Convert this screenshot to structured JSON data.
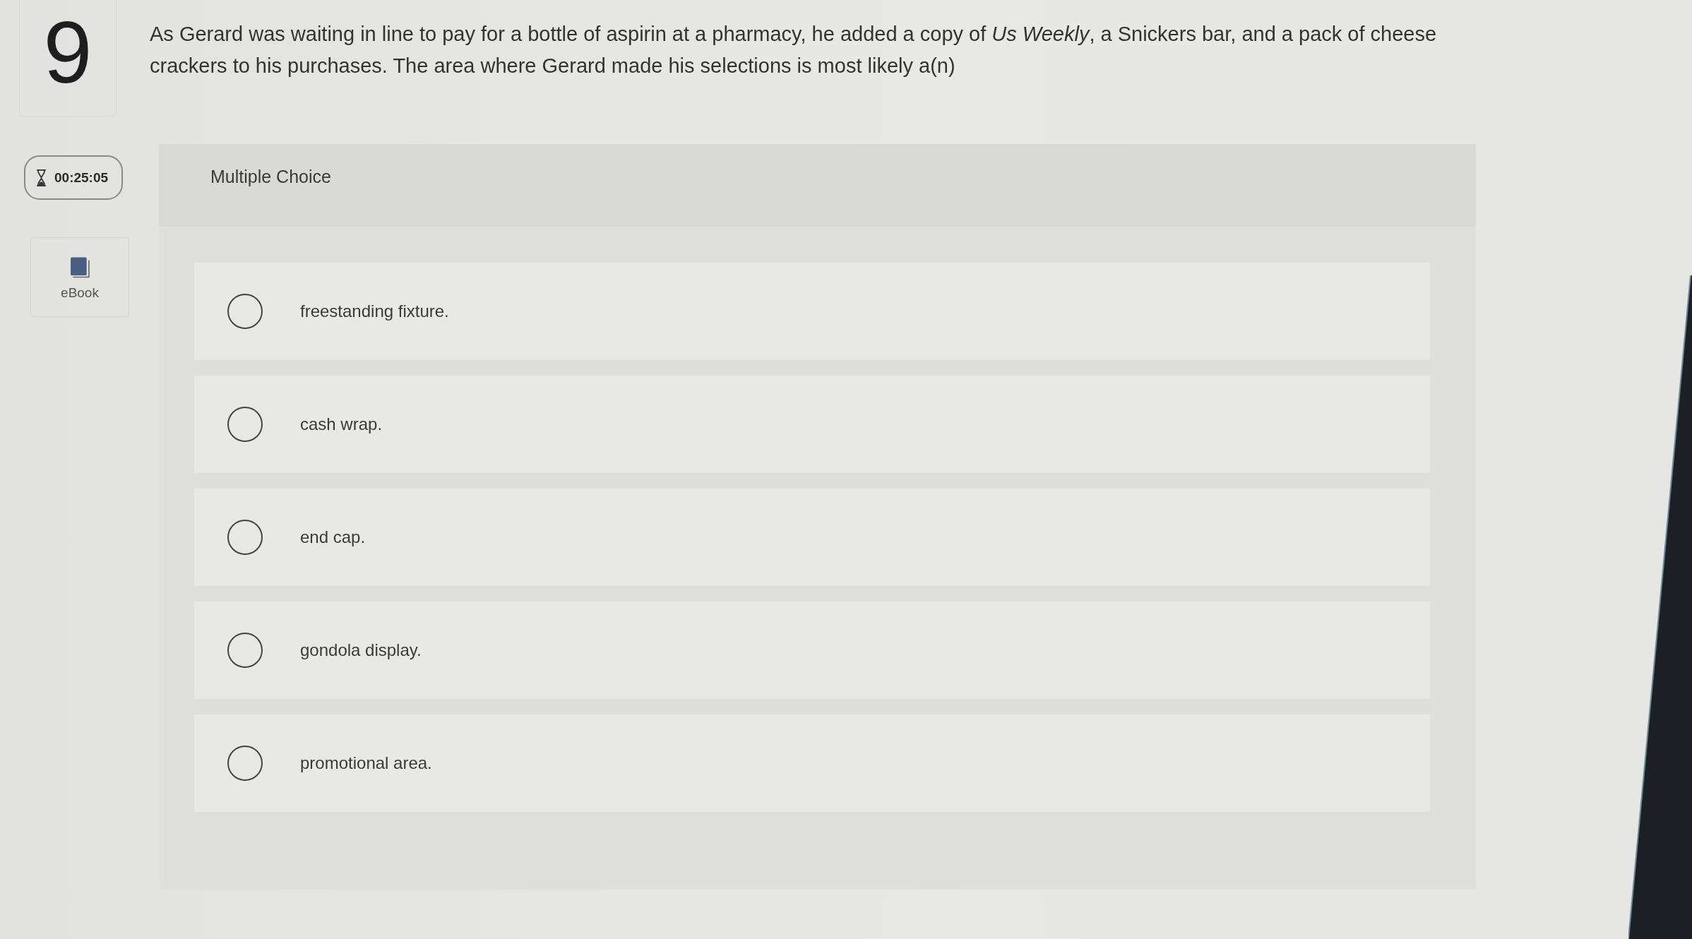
{
  "question": {
    "number": "9",
    "text": "As Gerard was waiting in line to pay for a bottle of aspirin at a pharmacy, he added a copy of *Us Weekly*, a Snickers bar, and a pack of cheese crackers to his purchases. The area where Gerard made his selections is most likely a(n)"
  },
  "timer": {
    "time": "00:25:05"
  },
  "ebook": {
    "label": "eBook"
  },
  "panel": {
    "title": "Multiple Choice"
  },
  "options": [
    {
      "label": "freestanding fixture.",
      "selected": false
    },
    {
      "label": "cash wrap.",
      "selected": false
    },
    {
      "label": "end cap.",
      "selected": false
    },
    {
      "label": "gondola display.",
      "selected": false
    },
    {
      "label": "promotional area.",
      "selected": false
    }
  ]
}
